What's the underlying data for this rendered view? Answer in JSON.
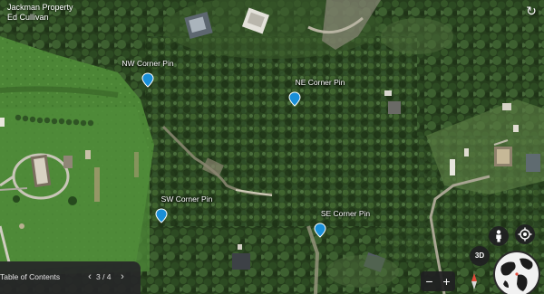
{
  "header": {
    "title": "Jackman Property",
    "author": "Ed Cullivan"
  },
  "pins": [
    {
      "name": "nw-corner-pin",
      "label": "NW Corner Pin"
    },
    {
      "name": "ne-corner-pin",
      "label": "NE Corner Pin"
    },
    {
      "name": "sw-corner-pin",
      "label": "SW Corner Pin"
    },
    {
      "name": "se-corner-pin",
      "label": "SE Corner Pin"
    }
  ],
  "toc": {
    "label": "Table of Contents",
    "prev_icon": "‹",
    "next_icon": "›",
    "count": "3 / 4"
  },
  "controls": {
    "three_d": "3D",
    "zoom_out": "−",
    "zoom_in": "+",
    "reset_icon": "↻"
  },
  "colors": {
    "pin": "#1a8fd8",
    "panel": "#262628",
    "forest": "#2e4a22",
    "field": "#4f8a3a"
  },
  "icons": [
    "reset-view-icon",
    "map-pin-icon",
    "person-icon",
    "locate-icon",
    "compass-icon",
    "globe-icon"
  ]
}
